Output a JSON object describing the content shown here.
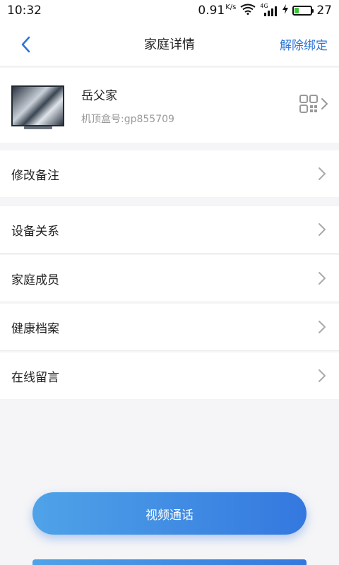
{
  "status_bar": {
    "time": "10:32",
    "net_speed": "0.91",
    "net_speed_unit": "K/s",
    "network_type": "4G",
    "battery_level": "27"
  },
  "header": {
    "back_icon": "chevron-left-icon",
    "title": "家庭详情",
    "unbind_label": "解除绑定",
    "accent_color": "#2f76d4"
  },
  "device": {
    "name": "岳父家",
    "stb_label": "机顶盒号:gp855709",
    "qr_icon": "qrcode-icon",
    "arrow_icon": "chevron-right-icon"
  },
  "menu": {
    "remark": "修改备注",
    "relations": "设备关系",
    "members": "家庭成员",
    "health": "健康档案",
    "messages": "在线留言"
  },
  "action": {
    "video_call": "视频通话",
    "gradient_start": "#4fa3e8",
    "gradient_end": "#3478df"
  }
}
